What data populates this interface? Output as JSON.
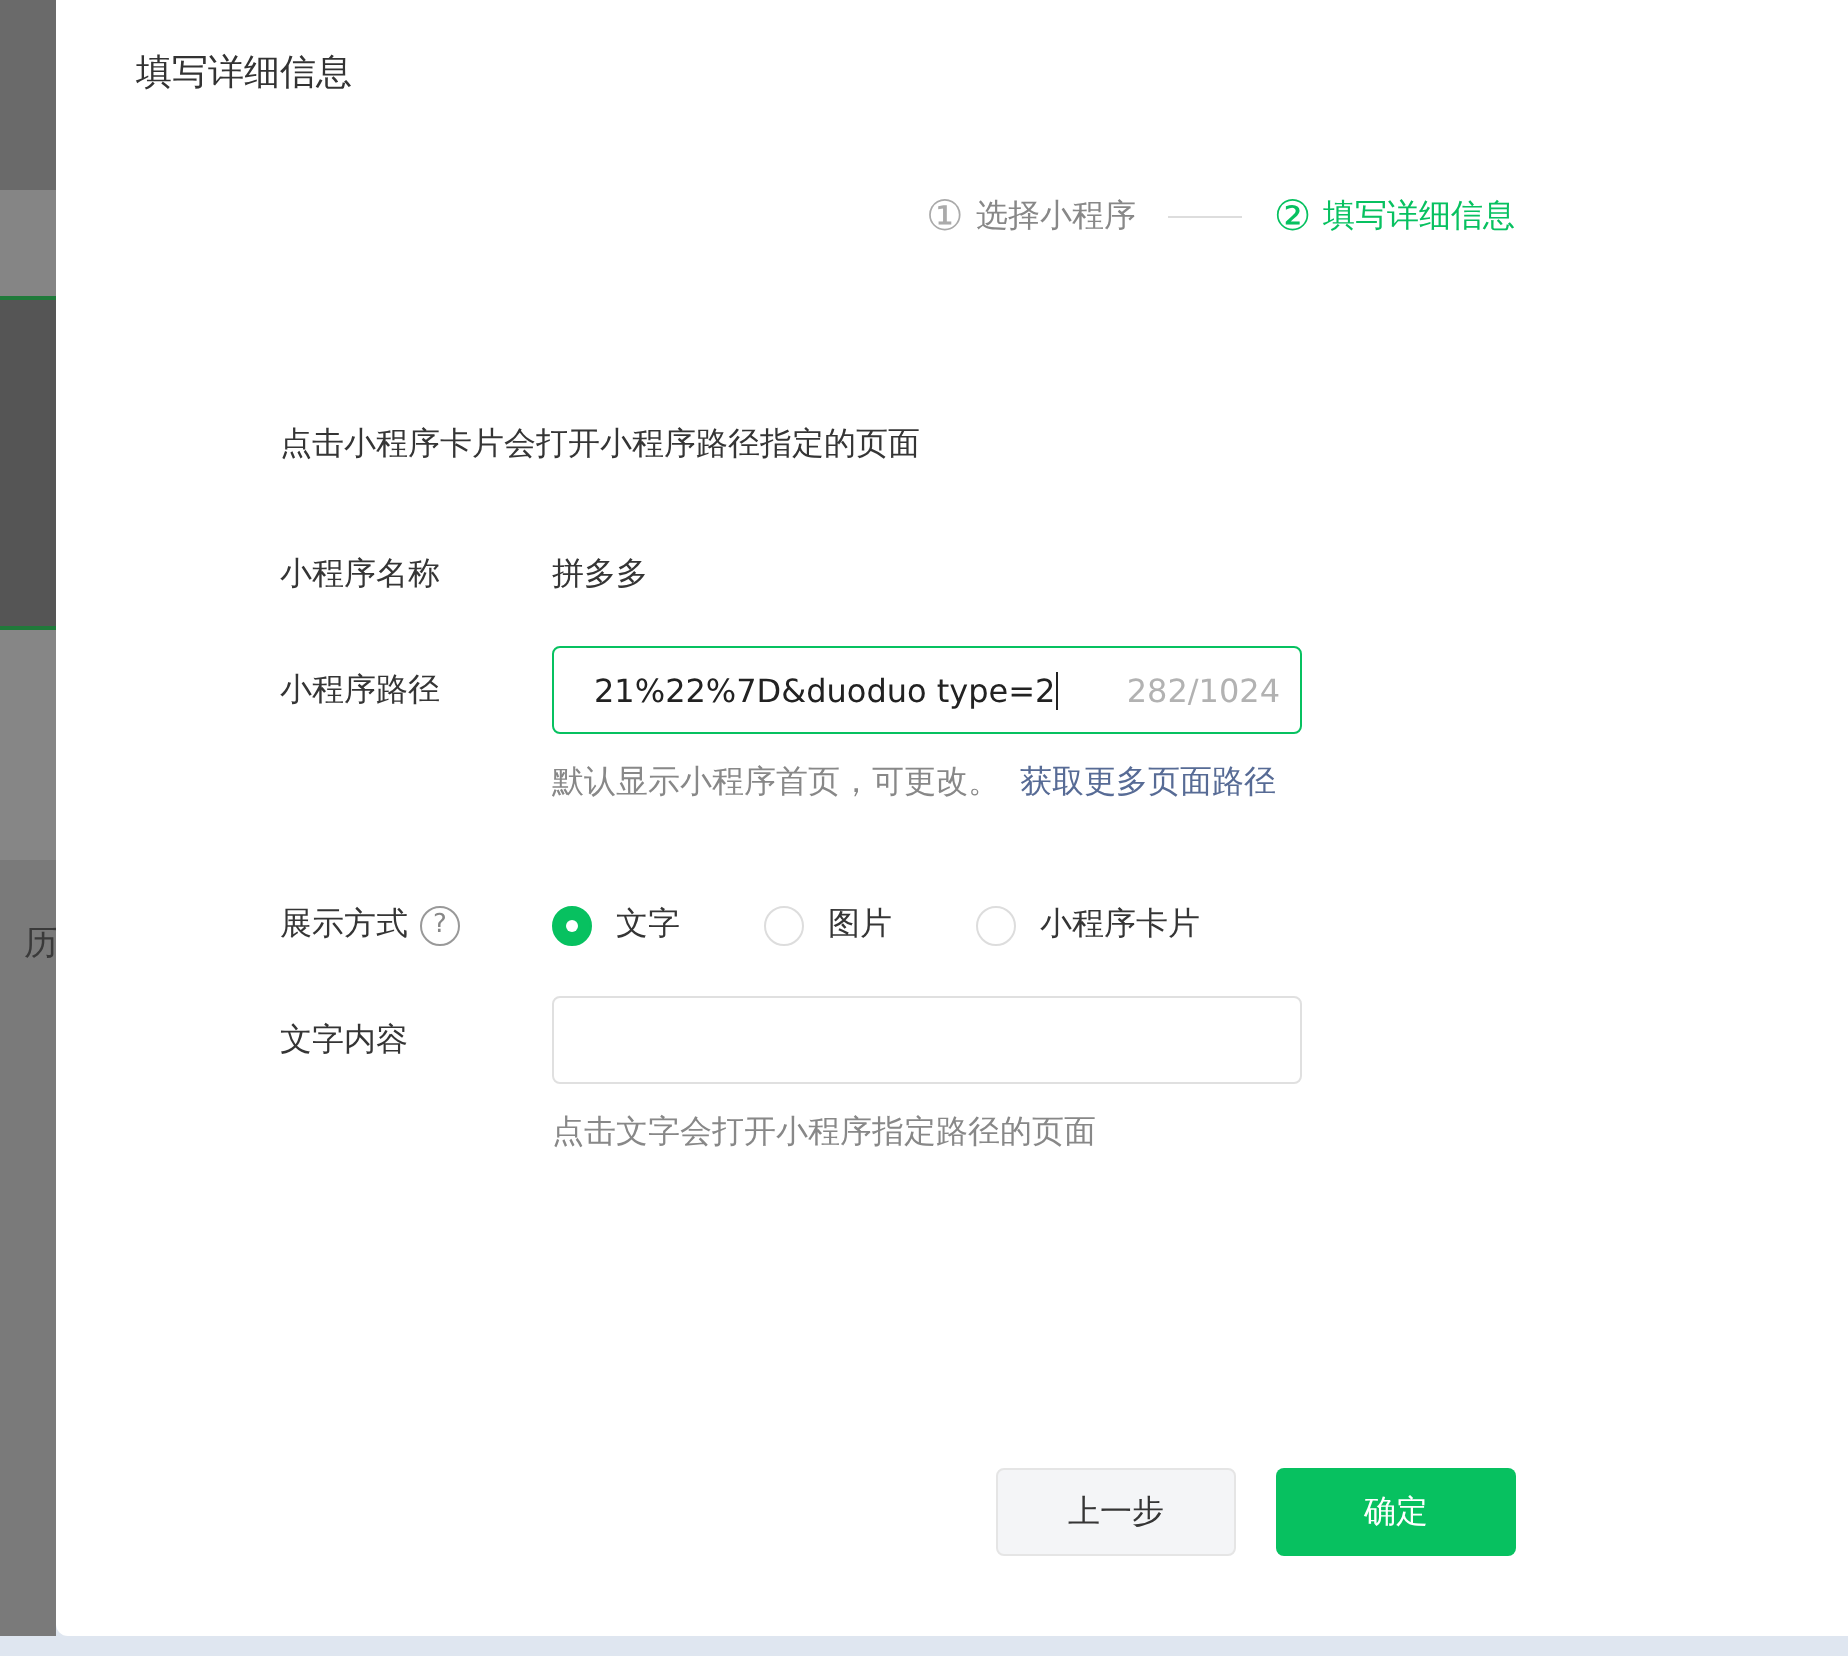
{
  "background": {
    "side_text": "历"
  },
  "dialog": {
    "title": "填写详细信息",
    "steps": [
      {
        "number": "①",
        "label": "选择小程序",
        "selected": false
      },
      {
        "number": "②",
        "label": "填写详细信息",
        "selected": true
      }
    ],
    "description": "点击小程序卡片会打开小程序路径指定的页面",
    "name_row": {
      "label": "小程序名称",
      "value": "拼多多"
    },
    "path_row": {
      "label": "小程序路径",
      "value": "21%22%7D&duoduo type=2",
      "counter": "282/1024",
      "focused": true,
      "hint": "默认显示小程序首页，可更改。",
      "link": "获取更多页面路径"
    },
    "display_row": {
      "label": "展示方式",
      "help": "?",
      "options": [
        {
          "label": "文字",
          "selected": true
        },
        {
          "label": "图片",
          "selected": false
        },
        {
          "label": "小程序卡片",
          "selected": false
        }
      ]
    },
    "text_row": {
      "label": "文字内容",
      "hint": "点击文字会打开小程序指定路径的页面"
    },
    "buttons": [
      {
        "label": "上一步",
        "kind": "secondary"
      },
      {
        "label": "确定",
        "kind": "primary"
      }
    ]
  }
}
